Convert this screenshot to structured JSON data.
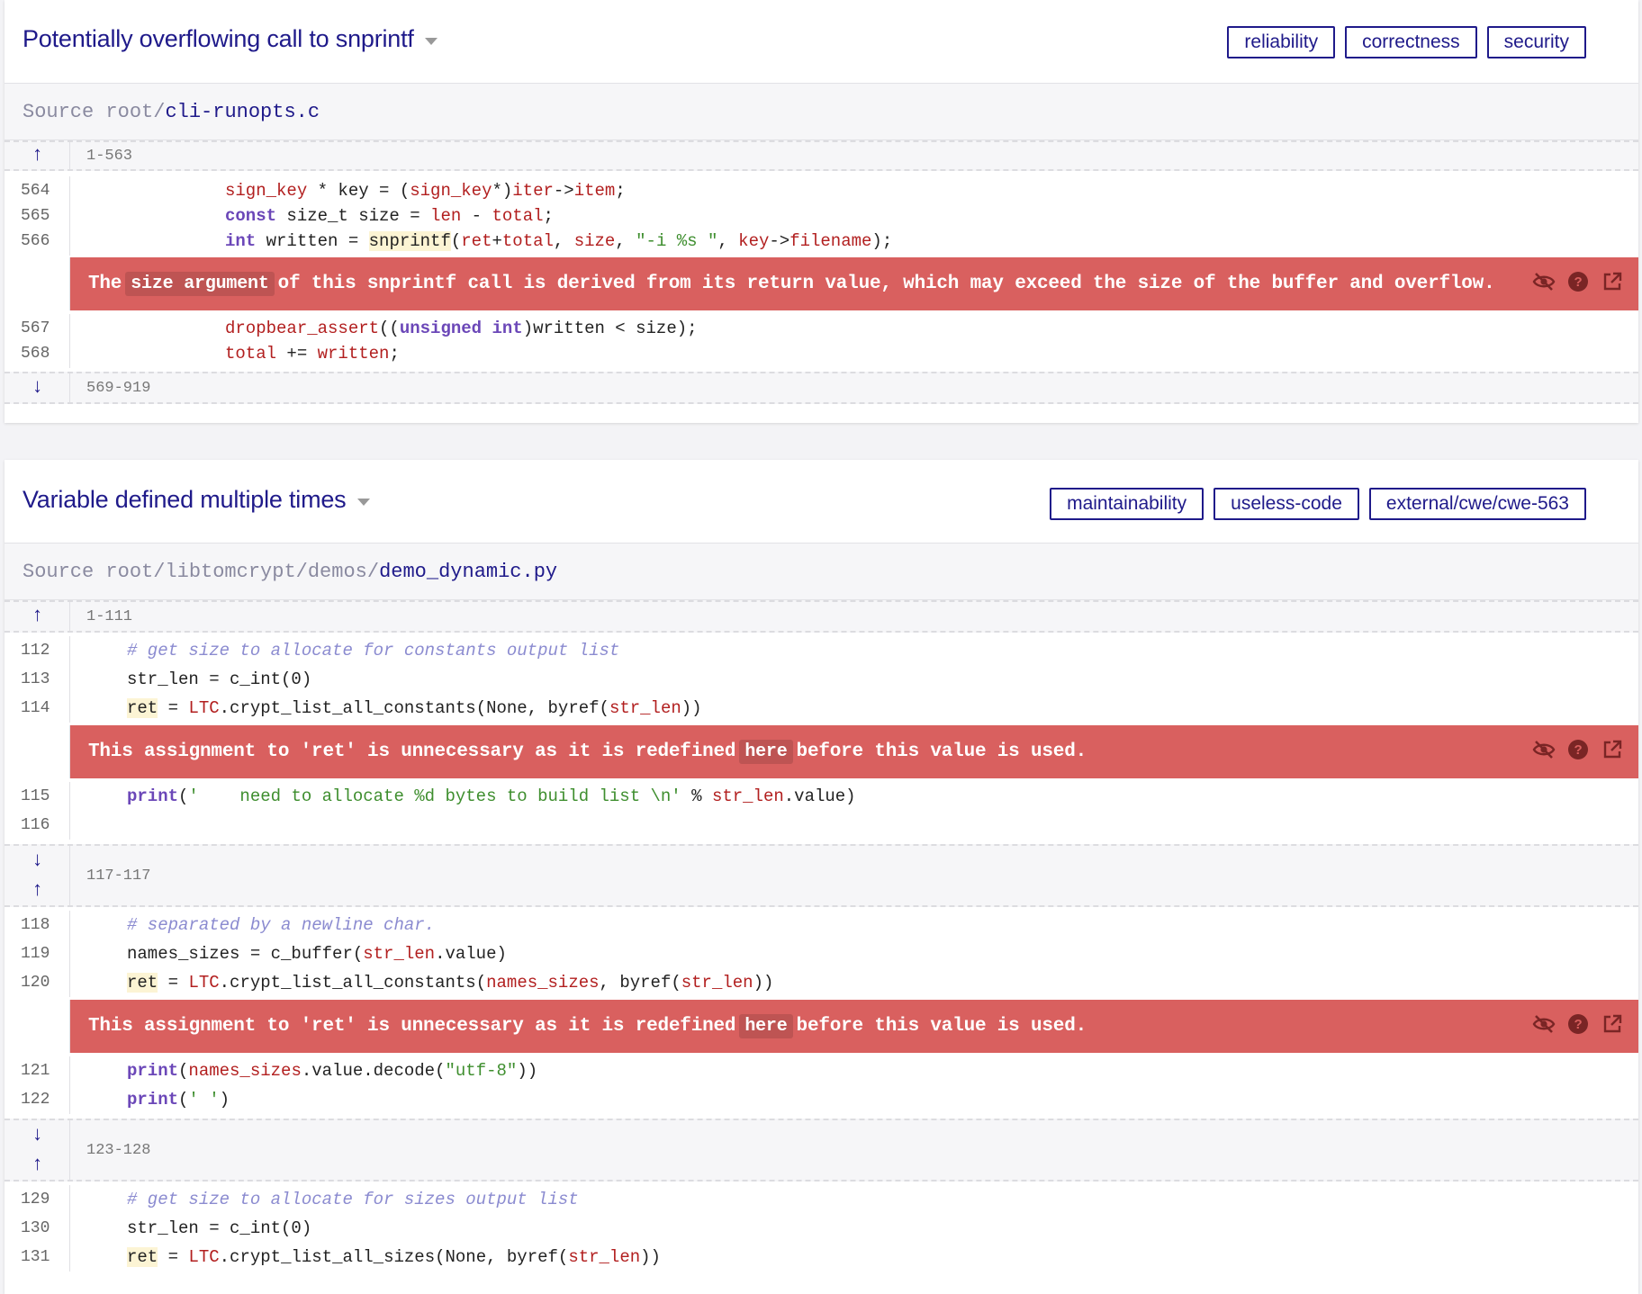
{
  "alerts": [
    {
      "title": "Potentially overflowing call to snprintf",
      "tags": [
        "reliability",
        "correctness",
        "security"
      ],
      "source_prefix": "Source root/",
      "source_file": "cli-runopts.c",
      "fold_top": "1-563",
      "fold_bottom": "569-919",
      "lines_before": [
        {
          "num": "564"
        },
        {
          "num": "565"
        },
        {
          "num": "566"
        }
      ],
      "message": {
        "pre": "The",
        "code": "size argument",
        "post": "of this snprintf call is derived from its return value, which may exceed the size of the buffer and overflow."
      },
      "lines_after": [
        {
          "num": "567"
        },
        {
          "num": "568"
        }
      ]
    },
    {
      "title": "Variable defined multiple times",
      "tags": [
        "maintainability",
        "useless-code",
        "external/cwe/cwe-563"
      ],
      "source_prefix": "Source root/libtomcrypt/demos/",
      "source_file": "demo_dynamic.py",
      "fold_top": "1-111",
      "fold_mid1": "117-117",
      "fold_mid2": "123-128",
      "lines_a": [
        {
          "num": "112"
        },
        {
          "num": "113"
        },
        {
          "num": "114"
        }
      ],
      "message1": {
        "pre": "This assignment to 'ret' is unnecessary as it is redefined",
        "code": "here",
        "post": "before this value is used."
      },
      "lines_b": [
        {
          "num": "115"
        },
        {
          "num": "116"
        }
      ],
      "lines_c": [
        {
          "num": "118"
        },
        {
          "num": "119"
        },
        {
          "num": "120"
        }
      ],
      "message2": {
        "pre": "This assignment to 'ret' is unnecessary as it is redefined",
        "code": "here",
        "post": "before this value is used."
      },
      "lines_d": [
        {
          "num": "121"
        },
        {
          "num": "122"
        }
      ],
      "lines_e": [
        {
          "num": "129"
        },
        {
          "num": "130"
        },
        {
          "num": "131"
        }
      ]
    }
  ],
  "code": {
    "l564": [
      "sign_key",
      " * key = (",
      "sign_key",
      "*)",
      "iter",
      "->",
      "item",
      ";"
    ],
    "l565": [
      "const",
      " size_t size = ",
      "len",
      " - ",
      "total",
      ";"
    ],
    "l566": [
      "int",
      " written = ",
      "snprintf",
      "(",
      "ret",
      "+",
      "total",
      ", ",
      "size",
      ", ",
      "\"-i %s \"",
      ", ",
      "key",
      "->",
      "filename",
      ");"
    ],
    "l567": [
      "dropbear_assert",
      "((",
      "unsigned",
      " ",
      "int",
      ")written < size);"
    ],
    "l568": [
      "total",
      " += ",
      "written",
      ";"
    ],
    "l112": "# get size to allocate for constants output list",
    "l113": "str_len = c_int(0)",
    "l114": [
      "ret",
      " = ",
      "LTC",
      ".crypt_list_all_constants(None, byref(",
      "str_len",
      "))"
    ],
    "l115": [
      "print",
      "(",
      "'    need to allocate %d bytes to build list \\n'",
      " % ",
      "str_len",
      ".value)"
    ],
    "l118": "# separated by a newline char.",
    "l119": [
      "names_sizes = c_buffer(",
      "str_len",
      ".value)"
    ],
    "l120": [
      "ret",
      " = ",
      "LTC",
      ".crypt_list_all_constants(",
      "names_sizes",
      ", byref(",
      "str_len",
      "))"
    ],
    "l121": [
      "print",
      "(",
      "names_sizes",
      ".value.decode(",
      "\"utf-8\"",
      "))"
    ],
    "l122": [
      "print",
      "(",
      "' '",
      ")"
    ],
    "l129": "# get size to allocate for sizes output list",
    "l130": "str_len = c_int(0)",
    "l131": [
      "ret",
      " = ",
      "LTC",
      ".crypt_list_all_sizes(None, byref(",
      "str_len",
      "))"
    ]
  },
  "icons": {
    "up": "↑",
    "down": "↓",
    "hide": "eye-slash-icon",
    "help": "question-circle-icon",
    "open": "external-link-icon"
  }
}
